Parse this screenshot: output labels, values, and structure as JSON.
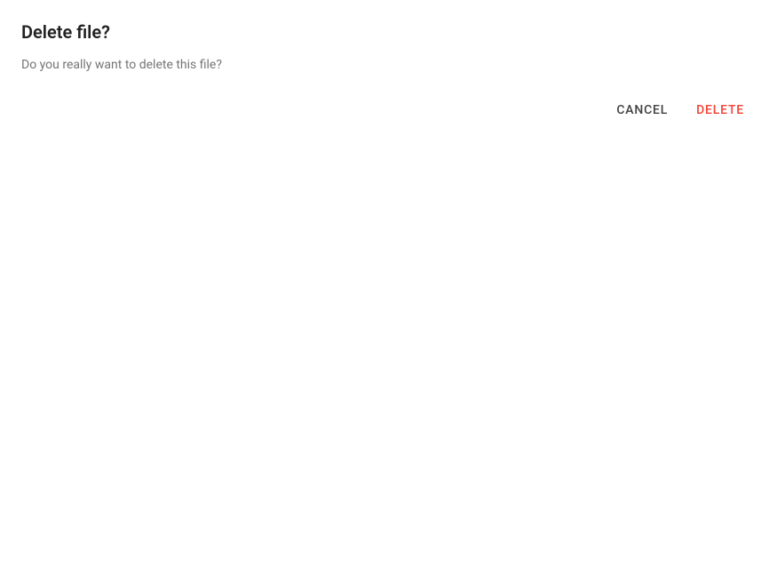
{
  "dialog": {
    "title": "Delete file?",
    "message": "Do you really want to delete this file?",
    "actions": {
      "cancel_label": "Cancel",
      "delete_label": "Delete"
    }
  }
}
